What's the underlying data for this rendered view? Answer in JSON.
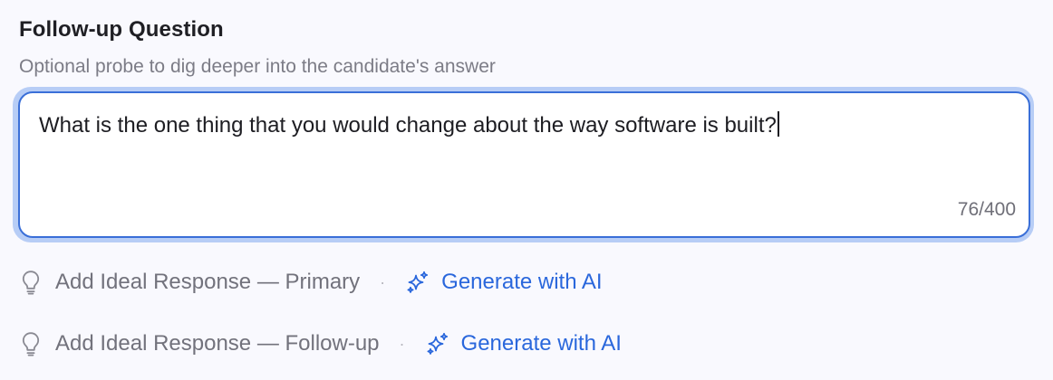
{
  "field": {
    "title": "Follow-up Question",
    "subtitle": "Optional probe to dig deeper into the candidate's answer",
    "value": "What is the one thing that you would change about the way software is built?",
    "counter": "76/400"
  },
  "actions": [
    {
      "label": "Add Ideal Response — Primary",
      "generate_label": "Generate with AI",
      "icon": "lightbulb-icon",
      "generate_icon": "sparkle-icon"
    },
    {
      "label": "Add Ideal Response — Follow-up",
      "generate_label": "Generate with AI",
      "icon": "lightbulb-icon",
      "generate_icon": "sparkle-icon"
    }
  ],
  "separator": "·",
  "colors": {
    "accent": "#2a67dc",
    "focus_border": "#3a6fd8",
    "focus_ring": "#b7cdf6",
    "muted_text": "#72727c",
    "background": "#f9f9fe"
  }
}
